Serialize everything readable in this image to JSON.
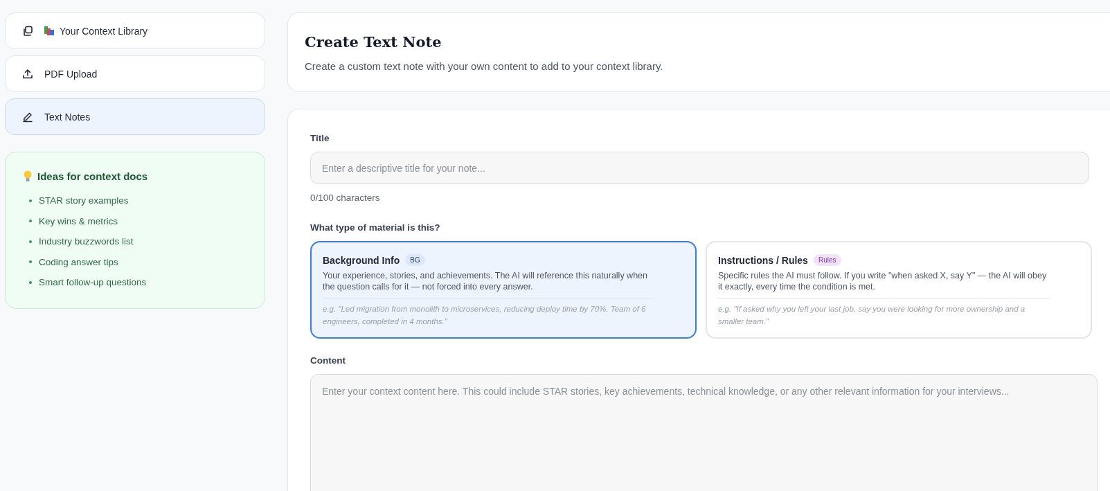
{
  "sidebar": {
    "items": [
      {
        "label": "Your Context Library",
        "kind": "library",
        "selected": false
      },
      {
        "label": "PDF Upload",
        "kind": "upload",
        "selected": false
      },
      {
        "label": "Text Notes",
        "kind": "pen",
        "selected": true
      }
    ],
    "ideas": {
      "title": "Ideas for context docs",
      "items": [
        "STAR story examples",
        "Key wins & metrics",
        "Industry buzzwords list",
        "Coding answer tips",
        "Smart follow-up questions"
      ]
    }
  },
  "header": {
    "title": "Create Text Note",
    "subtitle": "Create a custom text note with your own content to add to your context library."
  },
  "form": {
    "title_label": "Title",
    "title_placeholder": "Enter a descriptive title for your note...",
    "char_count": "0/100 characters",
    "type_label": "What type of material is this?",
    "types": [
      {
        "title": "Background Info",
        "badge": "BG",
        "kind": "background",
        "selected": true,
        "description": "Your experience, stories, and achievements. The AI will reference this naturally when the question calls for it — not forced into every answer.",
        "example": "e.g. \"Led migration from monolith to microservices, reducing deploy time by 70%. Team of 6 engineers, completed in 4 months.\""
      },
      {
        "title": "Instructions / Rules",
        "badge": "Rules",
        "kind": "rules",
        "selected": false,
        "description": "Specific rules the AI must follow. If you write \"when asked X, say Y\" — the AI will obey it exactly, every time the condition is met.",
        "example": "e.g. \"If asked why you left your last job, say you were looking for more ownership and a smaller team.\""
      }
    ],
    "content_label": "Content",
    "content_placeholder": "Enter your context content here. This could include STAR stories, key achievements, technical knowledge, or any other relevant information for your interviews..."
  }
}
